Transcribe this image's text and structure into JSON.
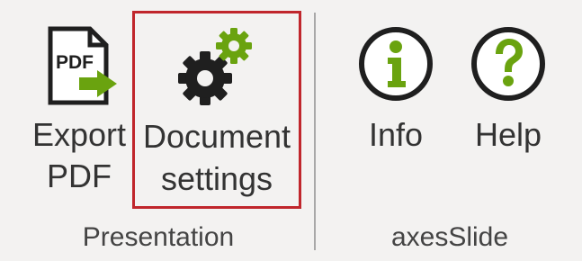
{
  "ribbon": {
    "groups": [
      {
        "label": "Presentation",
        "buttons": [
          {
            "label_line1": "Export",
            "label_line2": "PDF",
            "icon": "pdf-export-icon"
          },
          {
            "label_line1": "Document",
            "label_line2": "settings",
            "icon": "gears-icon",
            "selected": true
          }
        ]
      },
      {
        "label": "axesSlide",
        "buttons": [
          {
            "label_line1": "Info",
            "icon": "info-icon"
          },
          {
            "label_line1": "Help",
            "icon": "help-icon"
          }
        ]
      }
    ]
  },
  "pdf_icon_text": "PDF",
  "colors": {
    "background": "#f3f2f1",
    "accent_green": "#6aa30f",
    "icon_dark": "#1f1f1f",
    "selection_border": "#c0262c",
    "text": "#333333",
    "separator": "#a8a8a8"
  }
}
